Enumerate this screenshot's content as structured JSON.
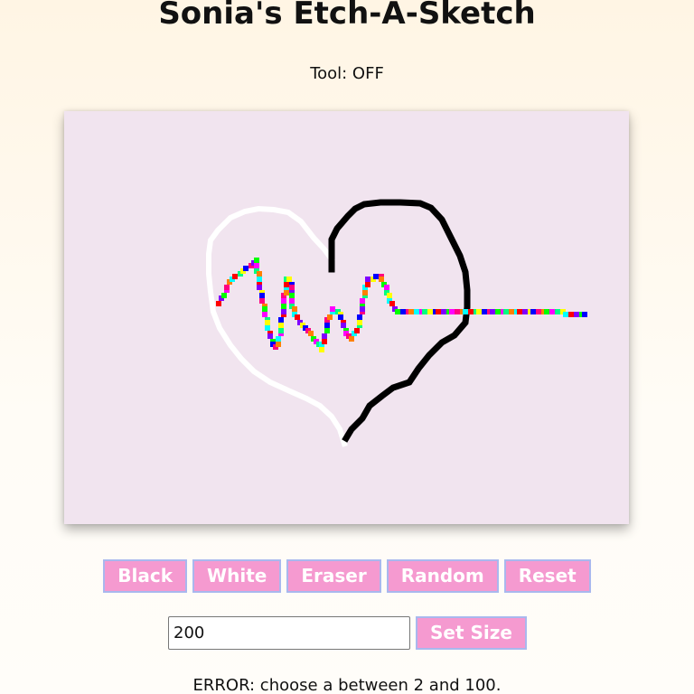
{
  "page": {
    "title": "Sonia's Etch-A-Sketch",
    "tool_status": "Tool: OFF"
  },
  "colors": {
    "background_top": "#fff5e4",
    "board_background": "#f1e4ef",
    "button_background": "#f59ad0",
    "button_border": "#a9b8ee",
    "button_text": "#ffffff",
    "ink_black": "#000000",
    "ink_white": "#ffffff"
  },
  "board": {
    "random_palette": [
      "#ff0000",
      "#ff00ff",
      "#0000ff",
      "#00ffff",
      "#00ff00",
      "#ffff00",
      "#ff8000",
      "#8000ff",
      "#00ff80",
      "#ff0080"
    ]
  },
  "toolbar": {
    "black_label": "Black",
    "white_label": "White",
    "eraser_label": "Eraser",
    "random_label": "Random",
    "reset_label": "Reset"
  },
  "size": {
    "value": "200",
    "button_label": "Set Size"
  },
  "message": {
    "error": "ERROR: choose a between 2 and 100."
  }
}
